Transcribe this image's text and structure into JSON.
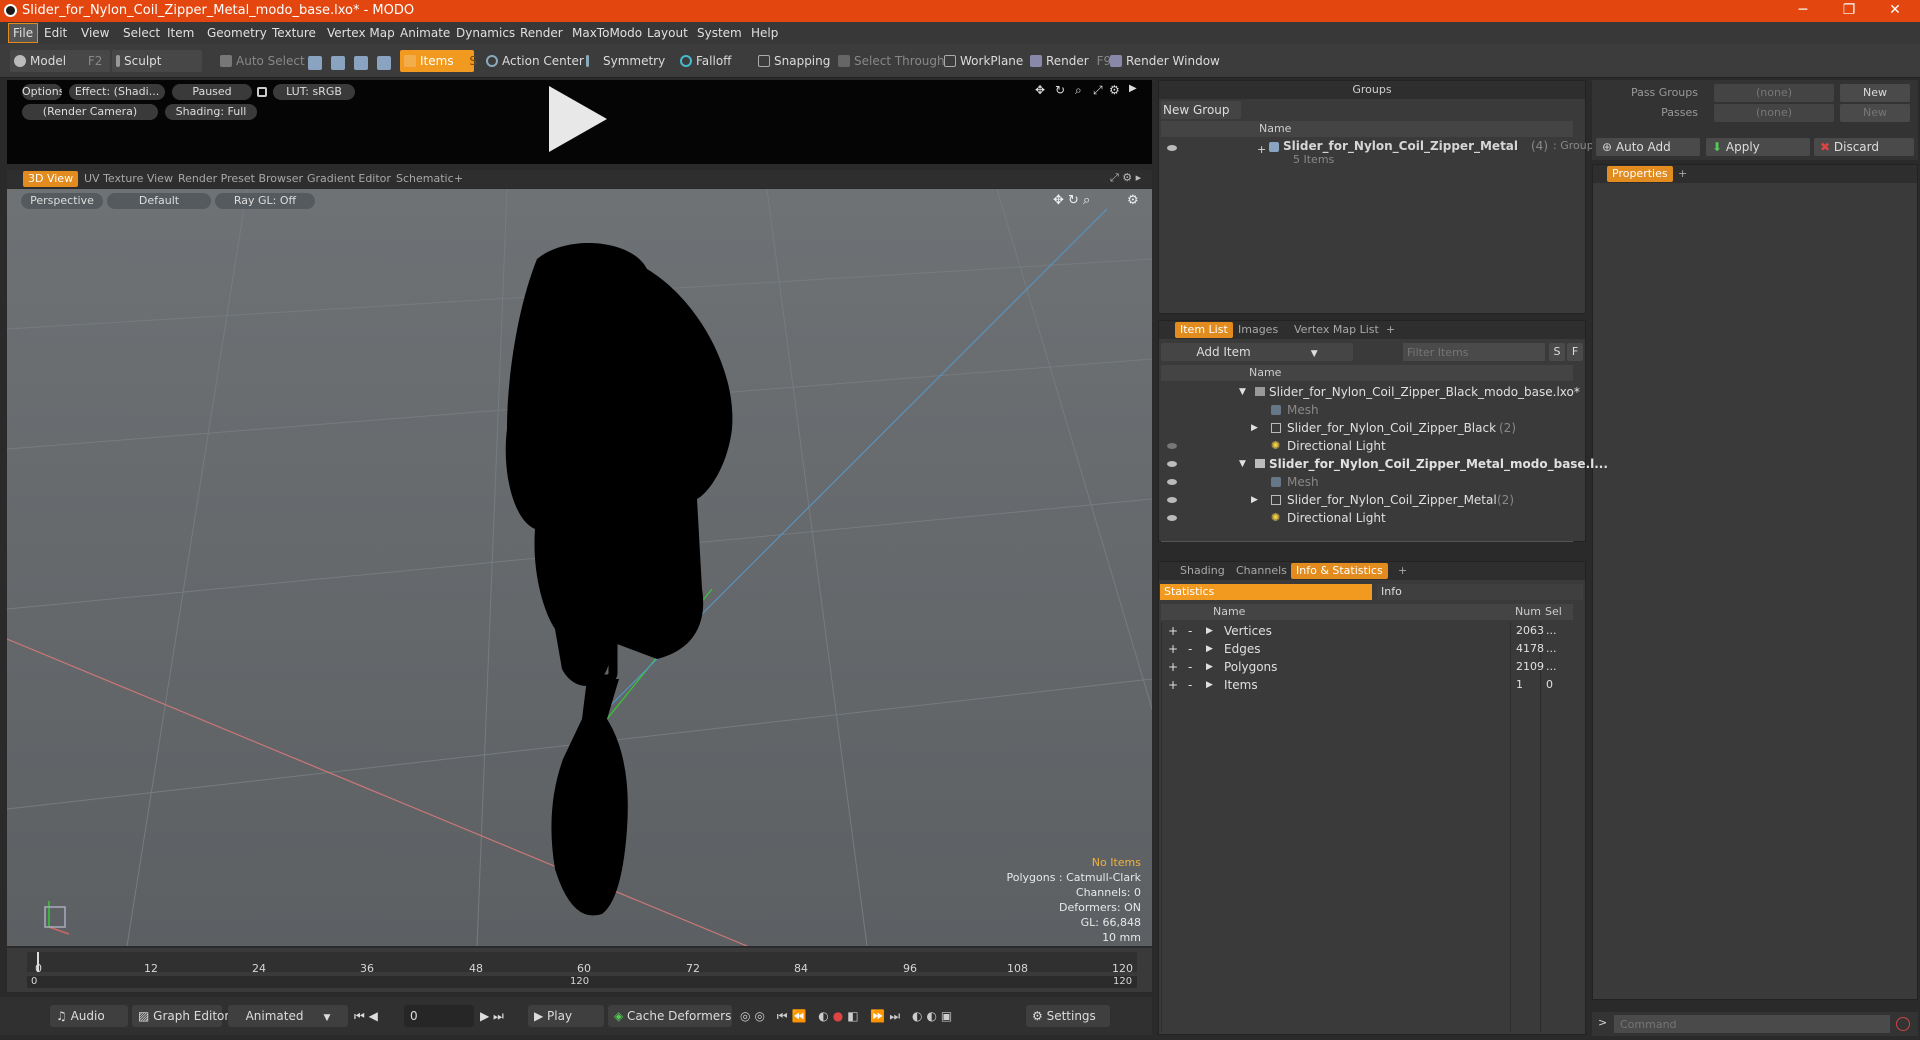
{
  "window": {
    "title": "Slider_for_Nylon_Coil_Zipper_Metal_modo_base.lxo* - MODO",
    "minimize": "─",
    "maximize": "❐",
    "close": "✕"
  },
  "menu": [
    "File",
    "Edit",
    "View",
    "Select",
    "Item",
    "Geometry",
    "Texture",
    "Vertex Map",
    "Animate",
    "Dynamics",
    "Render",
    "MaxToModo",
    "Layout",
    "System",
    "Help"
  ],
  "toolbar": {
    "model": "Model",
    "model_key": "F2",
    "sculpt": "Sculpt",
    "auto_select": "Auto Select",
    "items": "Items",
    "items_key": "S",
    "action_center": "Action Center",
    "symmetry": "Symmetry",
    "falloff": "Falloff",
    "snapping": "Snapping",
    "select_through": "Select Through",
    "workplane": "WorkPlane",
    "render": "Render",
    "render_key": "F9",
    "render_window": "Render Window"
  },
  "preview": {
    "options": "Options",
    "effect": "Effect: (Shadi...",
    "paused": "Paused",
    "lut": "LUT: sRGB",
    "camera": "(Render Camera)",
    "shading": "Shading: Full"
  },
  "view_tabs": [
    "3D View",
    "UV Texture View",
    "Render Preset Browser",
    "Gradient Editor",
    "Schematic",
    "+"
  ],
  "viewport": {
    "perspective": "Perspective",
    "default": "Default",
    "raygl": "Ray GL: Off",
    "no_items": "No Items",
    "info": [
      "Polygons : Catmull-Clark",
      "Channels: 0",
      "Deformers: ON",
      "GL: 66,848",
      "10 mm"
    ]
  },
  "timeline": {
    "ticks": [
      "0",
      "12",
      "24",
      "36",
      "48",
      "60",
      "72",
      "84",
      "96",
      "108",
      "120"
    ],
    "range_start": "0",
    "range_mid": "120",
    "range_end": "120"
  },
  "bottombar": {
    "audio": "Audio",
    "graph_editor": "Graph Editor",
    "animated": "Animated",
    "frame": "0",
    "play": "Play",
    "cache_deformers": "Cache Deformers",
    "settings": "Settings"
  },
  "groups": {
    "title": "Groups",
    "new_group": "New Group",
    "name_col": "Name",
    "item_name": "Slider_for_Nylon_Coil_Zipper_Metal",
    "item_count": "(4)",
    "item_type": ": Group",
    "item_sub": "5 Items"
  },
  "pass": {
    "pass_groups": "Pass Groups",
    "passes": "Passes",
    "none1": "(none)",
    "none2": "(none)",
    "new1": "New",
    "new2": "New"
  },
  "actions": {
    "auto_add": "Auto Add",
    "apply": "Apply",
    "discard": "Discard"
  },
  "properties": {
    "tab": "Properties",
    "plus": "+"
  },
  "item_list": {
    "tabs": [
      "Item List",
      "Images",
      "Vertex Map List",
      "+"
    ],
    "add_item": "Add Item",
    "filter": "Filter Items",
    "s": "S",
    "f": "F",
    "name_col": "Name",
    "rows": [
      {
        "label": "Slider_for_Nylon_Coil_Zipper_Black_modo_base.lxo*",
        "count": ""
      },
      {
        "label": "Mesh",
        "count": ""
      },
      {
        "label": "Slider_for_Nylon_Coil_Zipper_Black",
        "count": "(2)"
      },
      {
        "label": "Directional Light",
        "count": ""
      },
      {
        "label": "Slider_for_Nylon_Coil_Zipper_Metal_modo_base.l...",
        "count": ""
      },
      {
        "label": "Mesh",
        "count": ""
      },
      {
        "label": "Slider_for_Nylon_Coil_Zipper_Metal",
        "count": "(2)"
      },
      {
        "label": "Directional Light",
        "count": ""
      }
    ]
  },
  "stats": {
    "tabs": [
      "Shading",
      "Channels",
      "Info & Statistics",
      "+"
    ],
    "sub_tabs": [
      "Statistics",
      "Info"
    ],
    "cols": [
      "Name",
      "Num",
      "Sel"
    ],
    "rows": [
      {
        "name": "Vertices",
        "num": "2063",
        "sel": "..."
      },
      {
        "name": "Edges",
        "num": "4178",
        "sel": "..."
      },
      {
        "name": "Polygons",
        "num": "2109",
        "sel": "..."
      },
      {
        "name": "Items",
        "num": "1",
        "sel": "0"
      }
    ]
  },
  "command": {
    "placeholder": "Command"
  }
}
